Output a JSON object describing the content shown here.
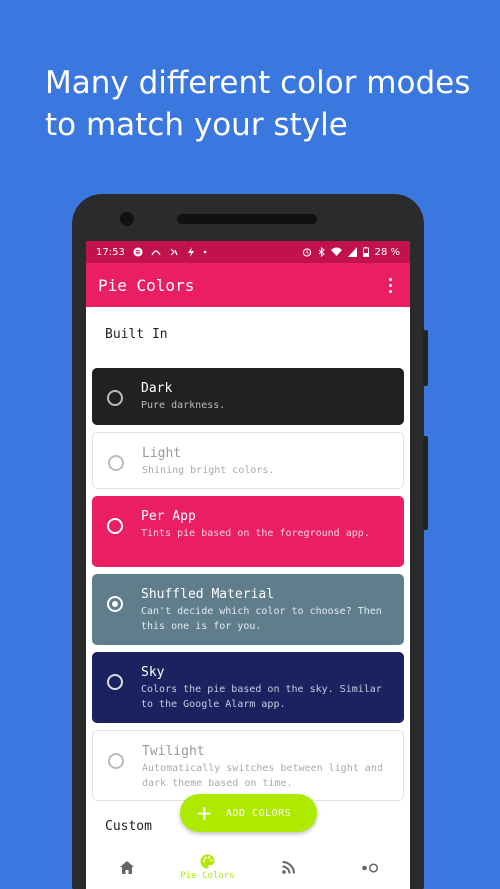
{
  "headline": {
    "line1": "Many different color modes",
    "line2": "to match your style"
  },
  "status_bar": {
    "time": "17:53",
    "battery": "28 %"
  },
  "app_bar": {
    "title": "Pie Colors",
    "overflow_icon": "more-vert-icon"
  },
  "sections": {
    "built_in": "Built In",
    "custom": "Custom"
  },
  "themes": [
    {
      "name": "Dark",
      "desc": "Pure darkness.",
      "selected": false,
      "color": "#212121"
    },
    {
      "name": "Light",
      "desc": "Shining bright colors.",
      "selected": false,
      "color": "#ffffff"
    },
    {
      "name": "Per App",
      "desc": "Tints pie based on the foreground app.",
      "selected": false,
      "color": "#e91e63"
    },
    {
      "name": "Shuffled Material",
      "desc": "Can't decide which color to choose? Then this one is for you.",
      "selected": true,
      "color": "#607d8b"
    },
    {
      "name": "Sky",
      "desc": "Colors the pie based on the sky. Similar to the Google Alarm app.",
      "selected": false,
      "color": "#1a2360"
    },
    {
      "name": "Twilight",
      "desc": "Automatically switches between light and dark theme based on time.",
      "selected": false,
      "color": "#ffffff"
    }
  ],
  "fab": {
    "label": "ADD COLORS"
  },
  "bottom_nav": {
    "items": [
      {
        "icon": "home-icon",
        "label": ""
      },
      {
        "icon": "palette-icon",
        "label": "Pie Colors"
      },
      {
        "icon": "rss-feed-icon",
        "label": ""
      },
      {
        "icon": "toggle-dots-icon",
        "label": ""
      }
    ]
  },
  "colors": {
    "background": "#3a77df",
    "primary": "#e91e63",
    "primary_dark": "#c1124f",
    "accent": "#aeea00"
  }
}
